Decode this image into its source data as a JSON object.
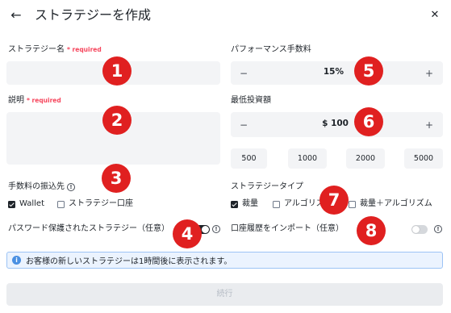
{
  "header": {
    "back_icon": "arrow-left-icon",
    "title": "ストラテジーを作成",
    "close_icon": "close-icon"
  },
  "strategy_name": {
    "label": "ストラテジー名",
    "required": "* required",
    "value": ""
  },
  "description": {
    "label": "説明",
    "required": "* required",
    "value": ""
  },
  "performance_fee": {
    "label": "パフォーマンス手数料",
    "minus": "−",
    "value": "15%",
    "plus": "+"
  },
  "min_investment": {
    "label": "最低投資額",
    "minus": "−",
    "value": "$ 100",
    "plus": "+",
    "presets": [
      "500",
      "1000",
      "2000",
      "5000"
    ]
  },
  "fee_destination": {
    "label": "手数料の振込先",
    "info_icon": "info-icon",
    "options": [
      {
        "label": "Wallet",
        "checked": true
      },
      {
        "label": "ストラテジー口座",
        "checked": false
      }
    ]
  },
  "strategy_type": {
    "label": "ストラテジータイプ",
    "options": [
      {
        "label": "裁量",
        "checked": true
      },
      {
        "label": "アルゴリズム",
        "checked": false
      },
      {
        "label": "裁量＋アルゴリズム",
        "checked": false
      }
    ]
  },
  "password_protected": {
    "label": "パスワード保護されたストラテジー（任意）",
    "enabled": true
  },
  "import_history": {
    "label": "口座履歴をインポート（任意）",
    "enabled": false
  },
  "notice": {
    "text": "お客様の新しいストラテジーは1時間後に表示されます。"
  },
  "submit": {
    "label": "続行"
  },
  "badges": [
    "1",
    "2",
    "3",
    "4",
    "5",
    "6",
    "7",
    "8"
  ],
  "colors": {
    "badge": "#e02020",
    "required": "#f6465d",
    "notice_bg": "#ebf3fe",
    "notice_border": "#9cc3f5",
    "field_bg": "#f3f4f6"
  }
}
